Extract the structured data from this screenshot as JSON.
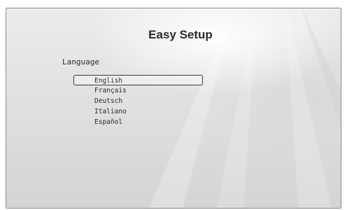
{
  "screen": {
    "title": "Easy Setup",
    "section_label": "Language",
    "options": [
      {
        "label": "English",
        "selected": true
      },
      {
        "label": "Français",
        "selected": false
      },
      {
        "label": "Deutsch",
        "selected": false
      },
      {
        "label": "Italiano",
        "selected": false
      },
      {
        "label": "Español",
        "selected": false
      }
    ]
  }
}
